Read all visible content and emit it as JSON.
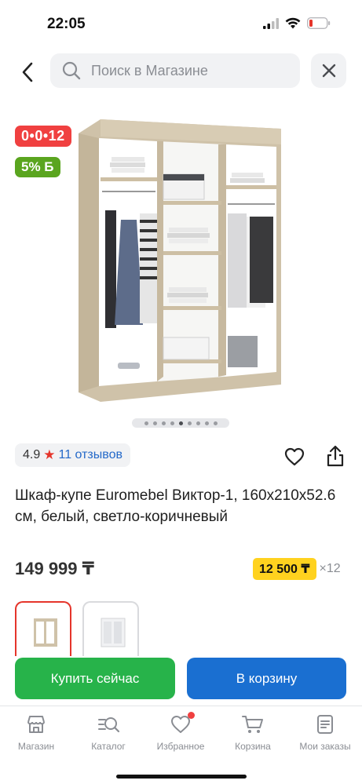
{
  "status_bar": {
    "time": "22:05",
    "icons": [
      "cellular-icon",
      "wifi-icon",
      "battery-low-icon"
    ],
    "battery_color": "#e5352b"
  },
  "header": {
    "search_placeholder": "Поиск в Магазине",
    "icons": {
      "back": "chevron-left-icon",
      "search": "search-icon",
      "close": "close-icon"
    }
  },
  "product": {
    "badges": {
      "installment": "0•0•12",
      "bonus": "5% Б"
    },
    "gallery": {
      "slide_count": 9,
      "active_index": 5
    },
    "rating": {
      "value": "4.9",
      "reviews_label": "11 отзывов"
    },
    "title": "Шкаф-купе Euromebel Виктор-1, 160x210x52.6 см, белый, светло-коричневый",
    "price": "149 999 ₸",
    "installment": {
      "amount": "12 500 ₸",
      "months": "×12"
    },
    "variants": [
      {
        "label": "светло-коричневый",
        "selected": true
      },
      {
        "label": "белый",
        "selected": false
      }
    ]
  },
  "actions": {
    "buy_now": "Купить сейчас",
    "add_to_cart": "В корзину"
  },
  "tabs": [
    {
      "label": "Магазин",
      "icon": "store-icon"
    },
    {
      "label": "Каталог",
      "icon": "catalog-search-icon"
    },
    {
      "label": "Избранное",
      "icon": "heart-icon",
      "has_dot": true
    },
    {
      "label": "Корзина",
      "icon": "cart-icon"
    },
    {
      "label": "Мои заказы",
      "icon": "orders-icon"
    }
  ],
  "colors": {
    "accent_green": "#27b34a",
    "accent_blue": "#1a6fd1",
    "badge_red": "#f04040",
    "bonus_green": "#5aa51f",
    "installment_yellow": "#ffd21f",
    "link_blue": "#2469c9"
  }
}
